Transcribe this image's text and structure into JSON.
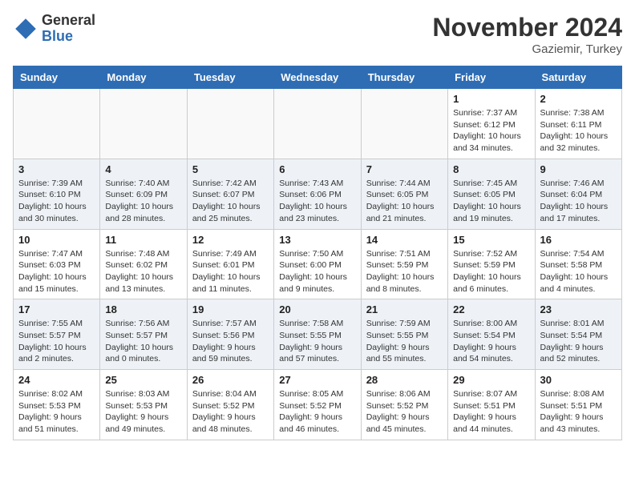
{
  "header": {
    "logo_general": "General",
    "logo_blue": "Blue",
    "month_title": "November 2024",
    "location": "Gaziemir, Turkey"
  },
  "weekdays": [
    "Sunday",
    "Monday",
    "Tuesday",
    "Wednesday",
    "Thursday",
    "Friday",
    "Saturday"
  ],
  "weeks": [
    [
      {
        "day": "",
        "info": ""
      },
      {
        "day": "",
        "info": ""
      },
      {
        "day": "",
        "info": ""
      },
      {
        "day": "",
        "info": ""
      },
      {
        "day": "",
        "info": ""
      },
      {
        "day": "1",
        "info": "Sunrise: 7:37 AM\nSunset: 6:12 PM\nDaylight: 10 hours\nand 34 minutes."
      },
      {
        "day": "2",
        "info": "Sunrise: 7:38 AM\nSunset: 6:11 PM\nDaylight: 10 hours\nand 32 minutes."
      }
    ],
    [
      {
        "day": "3",
        "info": "Sunrise: 7:39 AM\nSunset: 6:10 PM\nDaylight: 10 hours\nand 30 minutes."
      },
      {
        "day": "4",
        "info": "Sunrise: 7:40 AM\nSunset: 6:09 PM\nDaylight: 10 hours\nand 28 minutes."
      },
      {
        "day": "5",
        "info": "Sunrise: 7:42 AM\nSunset: 6:07 PM\nDaylight: 10 hours\nand 25 minutes."
      },
      {
        "day": "6",
        "info": "Sunrise: 7:43 AM\nSunset: 6:06 PM\nDaylight: 10 hours\nand 23 minutes."
      },
      {
        "day": "7",
        "info": "Sunrise: 7:44 AM\nSunset: 6:05 PM\nDaylight: 10 hours\nand 21 minutes."
      },
      {
        "day": "8",
        "info": "Sunrise: 7:45 AM\nSunset: 6:05 PM\nDaylight: 10 hours\nand 19 minutes."
      },
      {
        "day": "9",
        "info": "Sunrise: 7:46 AM\nSunset: 6:04 PM\nDaylight: 10 hours\nand 17 minutes."
      }
    ],
    [
      {
        "day": "10",
        "info": "Sunrise: 7:47 AM\nSunset: 6:03 PM\nDaylight: 10 hours\nand 15 minutes."
      },
      {
        "day": "11",
        "info": "Sunrise: 7:48 AM\nSunset: 6:02 PM\nDaylight: 10 hours\nand 13 minutes."
      },
      {
        "day": "12",
        "info": "Sunrise: 7:49 AM\nSunset: 6:01 PM\nDaylight: 10 hours\nand 11 minutes."
      },
      {
        "day": "13",
        "info": "Sunrise: 7:50 AM\nSunset: 6:00 PM\nDaylight: 10 hours\nand 9 minutes."
      },
      {
        "day": "14",
        "info": "Sunrise: 7:51 AM\nSunset: 5:59 PM\nDaylight: 10 hours\nand 8 minutes."
      },
      {
        "day": "15",
        "info": "Sunrise: 7:52 AM\nSunset: 5:59 PM\nDaylight: 10 hours\nand 6 minutes."
      },
      {
        "day": "16",
        "info": "Sunrise: 7:54 AM\nSunset: 5:58 PM\nDaylight: 10 hours\nand 4 minutes."
      }
    ],
    [
      {
        "day": "17",
        "info": "Sunrise: 7:55 AM\nSunset: 5:57 PM\nDaylight: 10 hours\nand 2 minutes."
      },
      {
        "day": "18",
        "info": "Sunrise: 7:56 AM\nSunset: 5:57 PM\nDaylight: 10 hours\nand 0 minutes."
      },
      {
        "day": "19",
        "info": "Sunrise: 7:57 AM\nSunset: 5:56 PM\nDaylight: 9 hours\nand 59 minutes."
      },
      {
        "day": "20",
        "info": "Sunrise: 7:58 AM\nSunset: 5:55 PM\nDaylight: 9 hours\nand 57 minutes."
      },
      {
        "day": "21",
        "info": "Sunrise: 7:59 AM\nSunset: 5:55 PM\nDaylight: 9 hours\nand 55 minutes."
      },
      {
        "day": "22",
        "info": "Sunrise: 8:00 AM\nSunset: 5:54 PM\nDaylight: 9 hours\nand 54 minutes."
      },
      {
        "day": "23",
        "info": "Sunrise: 8:01 AM\nSunset: 5:54 PM\nDaylight: 9 hours\nand 52 minutes."
      }
    ],
    [
      {
        "day": "24",
        "info": "Sunrise: 8:02 AM\nSunset: 5:53 PM\nDaylight: 9 hours\nand 51 minutes."
      },
      {
        "day": "25",
        "info": "Sunrise: 8:03 AM\nSunset: 5:53 PM\nDaylight: 9 hours\nand 49 minutes."
      },
      {
        "day": "26",
        "info": "Sunrise: 8:04 AM\nSunset: 5:52 PM\nDaylight: 9 hours\nand 48 minutes."
      },
      {
        "day": "27",
        "info": "Sunrise: 8:05 AM\nSunset: 5:52 PM\nDaylight: 9 hours\nand 46 minutes."
      },
      {
        "day": "28",
        "info": "Sunrise: 8:06 AM\nSunset: 5:52 PM\nDaylight: 9 hours\nand 45 minutes."
      },
      {
        "day": "29",
        "info": "Sunrise: 8:07 AM\nSunset: 5:51 PM\nDaylight: 9 hours\nand 44 minutes."
      },
      {
        "day": "30",
        "info": "Sunrise: 8:08 AM\nSunset: 5:51 PM\nDaylight: 9 hours\nand 43 minutes."
      }
    ]
  ]
}
